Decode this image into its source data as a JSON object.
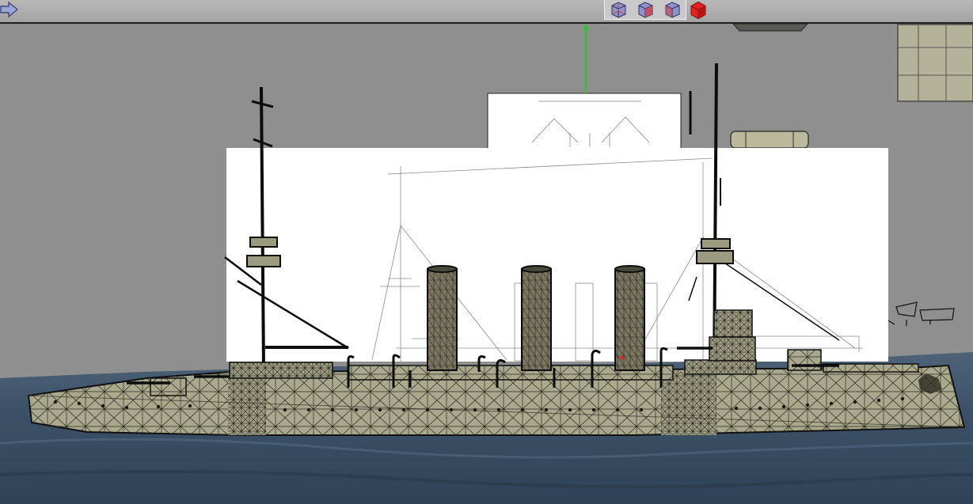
{
  "toolbar": {
    "nav_icon": "arrow-right-icon",
    "view_buttons": [
      {
        "name": "wireframe-cube-icon-1",
        "style": "wireframe"
      },
      {
        "name": "wireframe-cube-icon-2",
        "style": "wireframe"
      },
      {
        "name": "wireframe-cube-icon-3",
        "style": "wireframe"
      },
      {
        "name": "solid-cube-icon",
        "style": "solid"
      }
    ]
  },
  "viewport": {
    "scene": "armored-cruiser-model",
    "background_color": "#8f8f8f",
    "sea_color": "#3e5368",
    "hull_color": "#a8a88c",
    "reference_plane_color": "#ffffff",
    "gizmo_axis_color": "#26c826"
  }
}
